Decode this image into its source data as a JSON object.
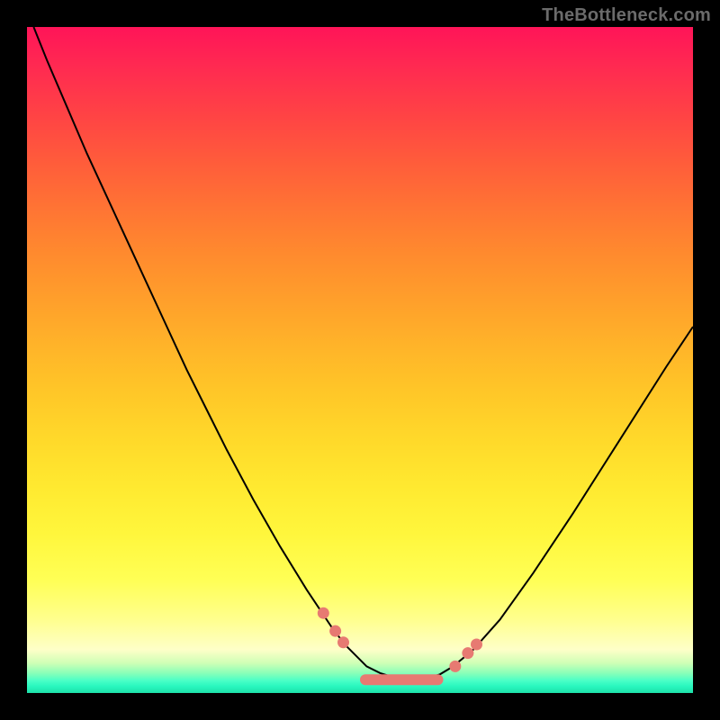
{
  "watermark": "TheBottleneck.com",
  "chart_data": {
    "type": "line",
    "title": "",
    "xlabel": "",
    "ylabel": "",
    "xlim": [
      0,
      100
    ],
    "ylim": [
      0,
      100
    ],
    "grid": false,
    "legend": false,
    "series": [
      {
        "name": "bottleneck-curve",
        "x": [
          1,
          3,
          6,
          9,
          12,
          15,
          18,
          21,
          24,
          27,
          30,
          34,
          38,
          42,
          46,
          48,
          49.5,
          51,
          53,
          55.5,
          58,
          60,
          62,
          64,
          67,
          71,
          76,
          82,
          89,
          96,
          100
        ],
        "y": [
          100,
          95,
          88,
          81,
          74.5,
          68,
          61.5,
          55,
          48.5,
          42.5,
          36.5,
          29,
          22,
          15.5,
          9.5,
          7,
          5.5,
          4,
          3,
          2.2,
          2,
          2.2,
          2.8,
          4,
          6.5,
          11,
          18,
          27,
          38,
          49,
          55
        ]
      },
      {
        "name": "highlighted-points",
        "x": [
          44.5,
          46.3,
          47.5,
          64.3,
          66.2,
          67.5
        ],
        "y": [
          12,
          9.3,
          7.6,
          4,
          6,
          7.3
        ]
      }
    ],
    "flat_bottom": {
      "x_start": 50,
      "x_end": 62.5,
      "y": 2
    }
  }
}
